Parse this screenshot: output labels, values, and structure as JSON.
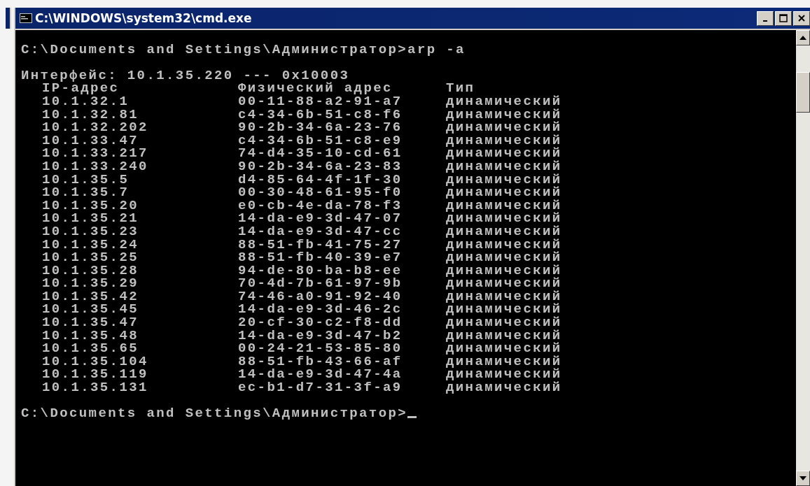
{
  "window": {
    "title": "C:\\WINDOWS\\system32\\cmd.exe"
  },
  "console": {
    "command": "C:\\Documents and Settings\\Администратор>arp -a",
    "interface_line": "Интерфейс: 10.1.35.220 --- 0x10003",
    "columns": [
      "IP-адрес",
      "Физический адрес",
      "Тип"
    ],
    "rows": [
      {
        "ip": "10.1.32.1",
        "mac": "00-11-88-a2-91-a7",
        "type": "динамический"
      },
      {
        "ip": "10.1.32.81",
        "mac": "c4-34-6b-51-c8-f6",
        "type": "динамический"
      },
      {
        "ip": "10.1.32.202",
        "mac": "90-2b-34-6a-23-76",
        "type": "динамический"
      },
      {
        "ip": "10.1.33.47",
        "mac": "c4-34-6b-51-c8-e9",
        "type": "динамический"
      },
      {
        "ip": "10.1.33.217",
        "mac": "74-d4-35-10-cd-61",
        "type": "динамический"
      },
      {
        "ip": "10.1.33.240",
        "mac": "90-2b-34-6a-23-83",
        "type": "динамический"
      },
      {
        "ip": "10.1.35.5",
        "mac": "d4-85-64-4f-1f-30",
        "type": "динамический"
      },
      {
        "ip": "10.1.35.7",
        "mac": "00-30-48-61-95-f0",
        "type": "динамический"
      },
      {
        "ip": "10.1.35.20",
        "mac": "e0-cb-4e-da-78-f3",
        "type": "динамический"
      },
      {
        "ip": "10.1.35.21",
        "mac": "14-da-e9-3d-47-07",
        "type": "динамический"
      },
      {
        "ip": "10.1.35.23",
        "mac": "14-da-e9-3d-47-cc",
        "type": "динамический"
      },
      {
        "ip": "10.1.35.24",
        "mac": "88-51-fb-41-75-27",
        "type": "динамический"
      },
      {
        "ip": "10.1.35.25",
        "mac": "88-51-fb-40-39-e7",
        "type": "динамический"
      },
      {
        "ip": "10.1.35.28",
        "mac": "94-de-80-ba-b8-ee",
        "type": "динамический"
      },
      {
        "ip": "10.1.35.29",
        "mac": "70-4d-7b-61-97-9b",
        "type": "динамический"
      },
      {
        "ip": "10.1.35.42",
        "mac": "74-46-a0-91-92-40",
        "type": "динамический"
      },
      {
        "ip": "10.1.35.45",
        "mac": "14-da-e9-3d-46-2c",
        "type": "динамический"
      },
      {
        "ip": "10.1.35.47",
        "mac": "20-cf-30-c2-f8-dd",
        "type": "динамический"
      },
      {
        "ip": "10.1.35.48",
        "mac": "14-da-e9-3d-47-b2",
        "type": "динамический"
      },
      {
        "ip": "10.1.35.65",
        "mac": "00-24-21-53-85-80",
        "type": "динамический"
      },
      {
        "ip": "10.1.35.104",
        "mac": "88-51-fb-43-66-af",
        "type": "динамический"
      },
      {
        "ip": "10.1.35.119",
        "mac": "14-da-e9-3d-47-4a",
        "type": "динамический"
      },
      {
        "ip": "10.1.35.131",
        "mac": "ec-b1-d7-31-3f-a9",
        "type": "динамический"
      }
    ],
    "prompt": "C:\\Documents and Settings\\Администратор>"
  }
}
